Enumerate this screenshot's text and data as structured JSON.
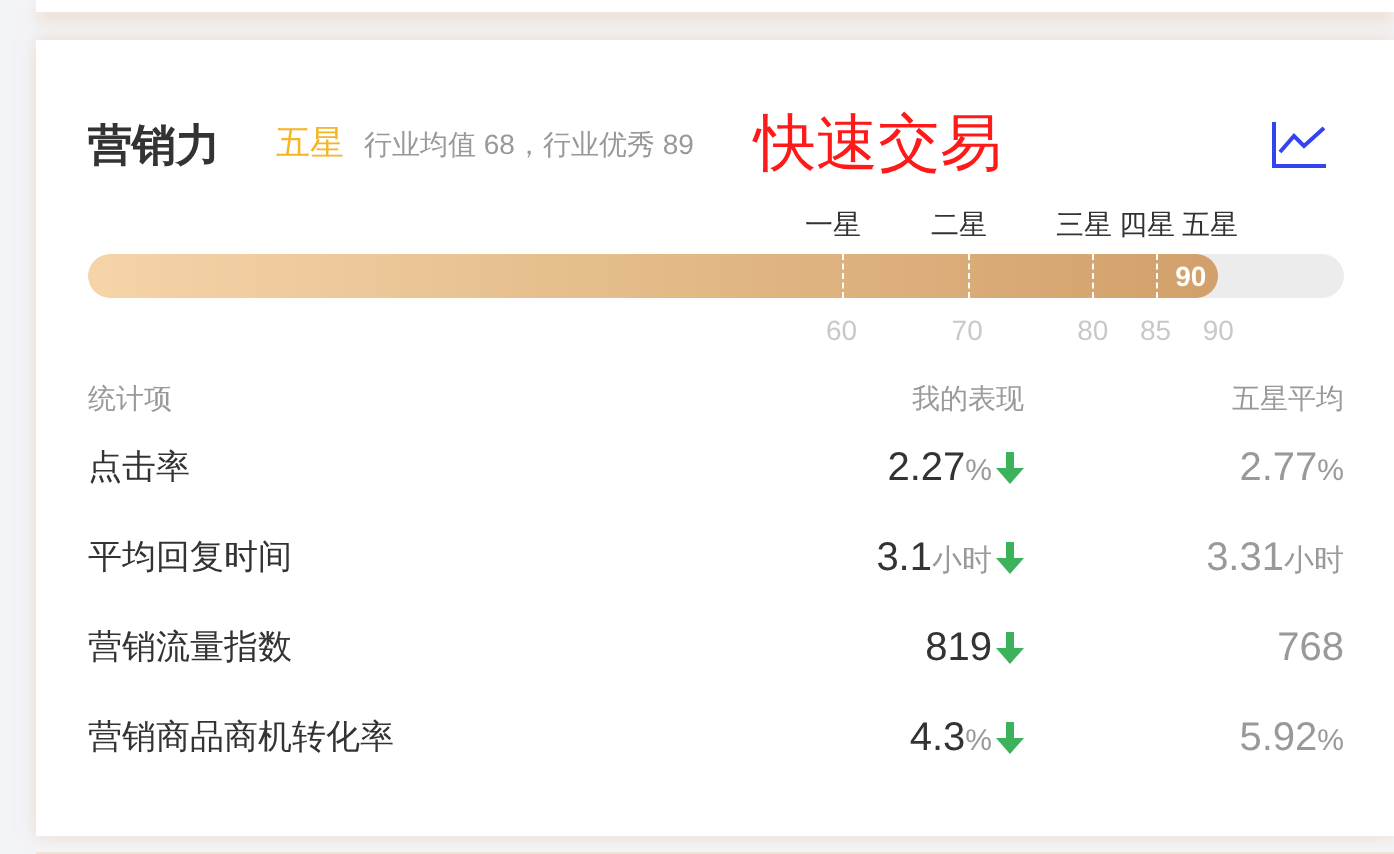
{
  "header": {
    "title": "营销力",
    "rating": "五星",
    "benchmark": "行业均值 68，行业优秀 89",
    "banner": "快速交易"
  },
  "progress": {
    "level": 0.9,
    "reading": "90",
    "ticks": [
      {
        "star": "一星",
        "value": "60"
      },
      {
        "star": "二星",
        "value": "70"
      },
      {
        "star": "三星",
        "value": "80"
      },
      {
        "star": "四星",
        "value": "85"
      },
      {
        "star": "五星",
        "value": "90"
      }
    ]
  },
  "table": {
    "columns": [
      "统计项",
      "我的表现",
      "五星平均"
    ],
    "rows": [
      {
        "name": "点击率",
        "mine": "2.27",
        "mine_unit": "%",
        "declining": true,
        "avg": "2.77",
        "avg_unit": "%"
      },
      {
        "name": "平均回复时间",
        "mine": "3.1",
        "mine_unit": "小时",
        "declining": true,
        "avg": "3.31",
        "avg_unit": "小时"
      },
      {
        "name": "营销流量指数",
        "mine": "819",
        "declining": true,
        "avg": "768"
      },
      {
        "name": "营销商品商机转化率",
        "mine": "4.3",
        "mine_unit": "%",
        "declining": true,
        "avg": "5.92",
        "avg_unit": "%"
      }
    ]
  }
}
